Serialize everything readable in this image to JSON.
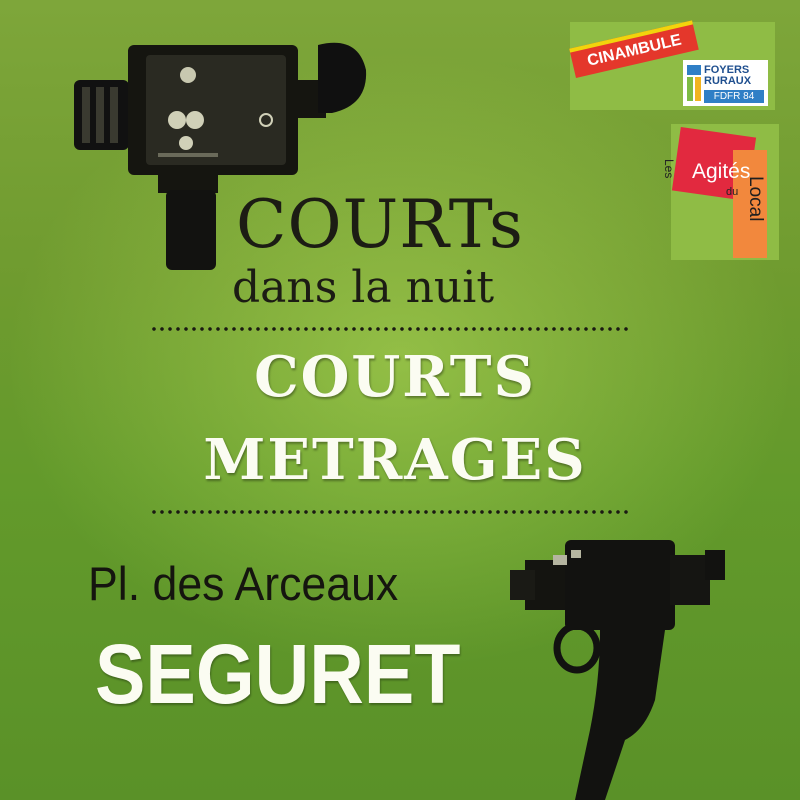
{
  "poster": {
    "title_line1": "COURTs",
    "title_line2": "dans la nuit",
    "headline_line1": "COURTS",
    "headline_line2": "METRAGES",
    "place": "Pl. des Arceaux",
    "town": "SEGURET"
  },
  "logos": {
    "cinambule": "CINAMBULE",
    "foyers_line1": "FOYERS",
    "foyers_line2": "RURAUX",
    "foyers_line3": "FDFR 84",
    "agites_les": "Les",
    "agites_main": "Agités",
    "agites_du": "du",
    "agites_local": "Local"
  },
  "colors": {
    "background": "#6f9b2f",
    "text_dark": "#1c1c14",
    "text_light": "#fbfcf2",
    "cinambule_red": "#e4372b",
    "cinambule_yellow": "#f2d40c",
    "foyers_blue": "#2f7fc6",
    "agites_red": "#e2293f",
    "agites_orange": "#f2883d"
  },
  "icons": [
    "super8-camera-icon",
    "handheld-camera-icon",
    "foyers-ruraux-mark-icon"
  ]
}
